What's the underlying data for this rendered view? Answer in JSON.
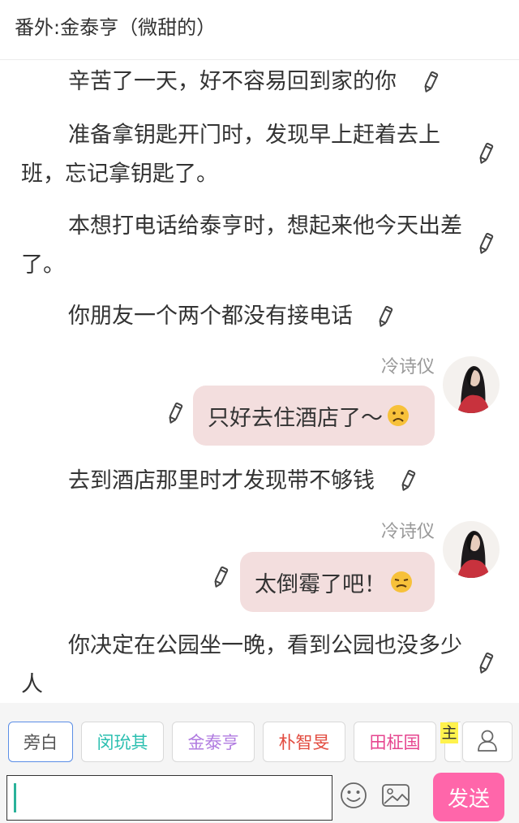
{
  "header": {
    "title": "番外:金泰亨（微甜的）"
  },
  "messages": {
    "n1": "辛苦了一天，好不容易回到家的你",
    "n2": "准备拿钥匙开门时，发现早上赶着去上班，忘记拿钥匙了。",
    "n3": "本想打电话给泰亨时，想起来他今天出差了。",
    "n4": "你朋友一个两个都没有接电话",
    "c1": {
      "sender": "冷诗仪",
      "text": "只好去住酒店了～",
      "emoji": "sad-face-emoji"
    },
    "n5": "去到酒店那里时才发现带不够钱",
    "c2": {
      "sender": "冷诗仪",
      "text": "太倒霉了吧！",
      "emoji": "upset-face-emoji"
    },
    "n6": "你决定在公园坐一晚，看到公园也没多少人"
  },
  "role_bar": {
    "roles": [
      {
        "label": "旁白",
        "color": "#555555"
      },
      {
        "label": "闵玧其",
        "color": "#2bbfb0"
      },
      {
        "label": "金泰亨",
        "color": "#b07be0"
      },
      {
        "label": "朴智旻",
        "color": "#e24b3f"
      },
      {
        "label": "田柾国",
        "color": "#e6458f"
      }
    ],
    "host_tag": "主",
    "user_icon": "user-icon"
  },
  "input_bar": {
    "input_value": "",
    "emoji_icon": "emoji-icon",
    "image_icon": "image-icon",
    "send_label": "发送"
  },
  "colors": {
    "bubble": "#f3dede",
    "send": "#ff66aa",
    "active_role_border": "#5b8ee6",
    "host_tag": "#fff24d"
  }
}
